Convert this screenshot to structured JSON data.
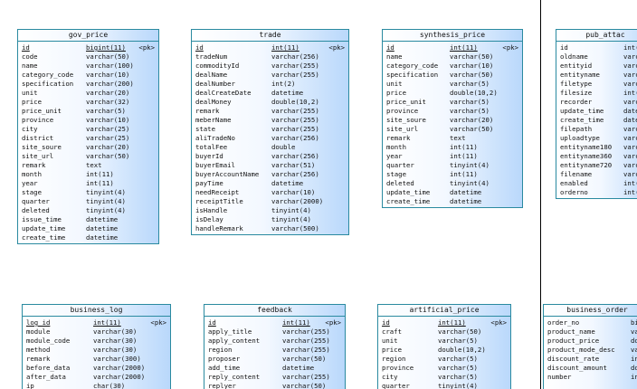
{
  "diagram": {
    "tables": [
      {
        "id": "gov_price",
        "title": "gov_price",
        "columns": [
          {
            "name": "id",
            "type": "bigint(11)",
            "key": "<pk>"
          },
          {
            "name": "code",
            "type": "varchar(50)"
          },
          {
            "name": "name",
            "type": "varchar(100)"
          },
          {
            "name": "category_code",
            "type": "varchar(10)"
          },
          {
            "name": "specification",
            "type": "varchar(200)"
          },
          {
            "name": "unit",
            "type": "varchar(20)"
          },
          {
            "name": "price",
            "type": "varchar(32)"
          },
          {
            "name": "price_unit",
            "type": "varchar(5)"
          },
          {
            "name": "province",
            "type": "varchar(10)"
          },
          {
            "name": "city",
            "type": "varchar(25)"
          },
          {
            "name": "district",
            "type": "varchar(25)"
          },
          {
            "name": "site_soure",
            "type": "varchar(20)"
          },
          {
            "name": "site_url",
            "type": "varchar(50)"
          },
          {
            "name": "remark",
            "type": "text"
          },
          {
            "name": "month",
            "type": "int(11)"
          },
          {
            "name": "year",
            "type": "int(11)"
          },
          {
            "name": "stage",
            "type": "tinyint(4)"
          },
          {
            "name": "quarter",
            "type": "tinyint(4)"
          },
          {
            "name": "deleted",
            "type": "tinyint(4)"
          },
          {
            "name": "issue_time",
            "type": "datetime"
          },
          {
            "name": "update_time",
            "type": "datetime"
          },
          {
            "name": "create_time",
            "type": "datetime"
          }
        ]
      },
      {
        "id": "trade",
        "title": "trade",
        "columns": [
          {
            "name": "id",
            "type": "int(11)",
            "key": "<pk>"
          },
          {
            "name": "tradeNum",
            "type": "varchar(256)"
          },
          {
            "name": "commodityId",
            "type": "varchar(255)"
          },
          {
            "name": "dealName",
            "type": "varchar(255)"
          },
          {
            "name": "dealNumber",
            "type": "int(2)"
          },
          {
            "name": "dealCreateDate",
            "type": "datetime"
          },
          {
            "name": "dealMoney",
            "type": "double(10,2)"
          },
          {
            "name": "remark",
            "type": "varchar(255)"
          },
          {
            "name": "meberName",
            "type": "varchar(255)"
          },
          {
            "name": "state",
            "type": "varchar(255)"
          },
          {
            "name": "aliTradeNo",
            "type": "varchar(256)"
          },
          {
            "name": "totalFee",
            "type": "double"
          },
          {
            "name": "buyerId",
            "type": "varchar(256)"
          },
          {
            "name": "buyerEmail",
            "type": "varchar(51)"
          },
          {
            "name": "buyerAccountName",
            "type": "varchar(256)"
          },
          {
            "name": "payTime",
            "type": "datetime"
          },
          {
            "name": "needReceipt",
            "type": "varchar(10)"
          },
          {
            "name": "receiptTitle",
            "type": "varchar(2000)"
          },
          {
            "name": "isHandle",
            "type": "tinyint(4)"
          },
          {
            "name": "isDelay",
            "type": "tinyint(4)"
          },
          {
            "name": "handleRemark",
            "type": "varchar(500)"
          }
        ]
      },
      {
        "id": "synthesis_price",
        "title": "synthesis_price",
        "columns": [
          {
            "name": "id",
            "type": "int(11)",
            "key": "<pk>"
          },
          {
            "name": "name",
            "type": "varchar(50)"
          },
          {
            "name": "category_code",
            "type": "varchar(10)"
          },
          {
            "name": "specification",
            "type": "varchar(50)"
          },
          {
            "name": "unit",
            "type": "varchar(5)"
          },
          {
            "name": "price",
            "type": "double(10,2)"
          },
          {
            "name": "price_unit",
            "type": "varchar(5)"
          },
          {
            "name": "province",
            "type": "varchar(5)"
          },
          {
            "name": "site_soure",
            "type": "varchar(20)"
          },
          {
            "name": "site_url",
            "type": "varchar(50)"
          },
          {
            "name": "remark",
            "type": "text"
          },
          {
            "name": "month",
            "type": "int(11)"
          },
          {
            "name": "year",
            "type": "int(11)"
          },
          {
            "name": "quarter",
            "type": "tinyint(4)"
          },
          {
            "name": "stage",
            "type": "int(11)"
          },
          {
            "name": "deleted",
            "type": "tinyint(4)"
          },
          {
            "name": "update_time",
            "type": "datetime"
          },
          {
            "name": "create_time",
            "type": "datetime"
          }
        ]
      },
      {
        "id": "pub_attach",
        "title": "pub_attac",
        "columns": [
          {
            "name": "id",
            "type": "int(",
            "key": ""
          },
          {
            "name": "oldname",
            "type": "varc"
          },
          {
            "name": "entityid",
            "type": "varc"
          },
          {
            "name": "entityname",
            "type": "varc"
          },
          {
            "name": "filetype",
            "type": "varc"
          },
          {
            "name": "filesize",
            "type": "int("
          },
          {
            "name": "recorder",
            "type": "varc"
          },
          {
            "name": "update_time",
            "type": "date"
          },
          {
            "name": "create_time",
            "type": "date"
          },
          {
            "name": "filepath",
            "type": "varc"
          },
          {
            "name": "uploadtype",
            "type": "varc"
          },
          {
            "name": "entityname180",
            "type": "varc"
          },
          {
            "name": "entityname360",
            "type": "varc"
          },
          {
            "name": "entityname720",
            "type": "varc"
          },
          {
            "name": "filename",
            "type": "varc"
          },
          {
            "name": "enabled",
            "type": "int("
          },
          {
            "name": "orderno",
            "type": "int("
          }
        ]
      },
      {
        "id": "business_log",
        "title": "business_log",
        "columns": [
          {
            "name": "log_id",
            "type": "int(11)",
            "key": "<pk>"
          },
          {
            "name": "module",
            "type": "varchar(30)"
          },
          {
            "name": "module_code",
            "type": "varchar(30)"
          },
          {
            "name": "method",
            "type": "varchar(30)"
          },
          {
            "name": "remark",
            "type": "varchar(300)"
          },
          {
            "name": "before_data",
            "type": "varchar(2000)"
          },
          {
            "name": "after_data",
            "type": "varchar(2000)"
          },
          {
            "name": "ip",
            "type": "char(30)"
          }
        ]
      },
      {
        "id": "feedback",
        "title": "feedback",
        "columns": [
          {
            "name": "id",
            "type": "int(11)",
            "key": "<pk>"
          },
          {
            "name": "apply_title",
            "type": "varchar(255)"
          },
          {
            "name": "apply_content",
            "type": "varchar(255)"
          },
          {
            "name": "region",
            "type": "varchar(255)"
          },
          {
            "name": "proposer",
            "type": "varchar(50)"
          },
          {
            "name": "add_time",
            "type": "datetime"
          },
          {
            "name": "reply_content",
            "type": "varchar(255)"
          },
          {
            "name": "replyer",
            "type": "varchar(50)"
          }
        ]
      },
      {
        "id": "artificial_price",
        "title": "artificial_price",
        "columns": [
          {
            "name": "id",
            "type": "int(11)",
            "key": "<pk>"
          },
          {
            "name": "craft",
            "type": "varchar(50)"
          },
          {
            "name": "unit",
            "type": "varchar(5)"
          },
          {
            "name": "price",
            "type": "double(10,2)"
          },
          {
            "name": "region",
            "type": "varchar(5)"
          },
          {
            "name": "province",
            "type": "varchar(5)"
          },
          {
            "name": "city",
            "type": "varchar(5)"
          },
          {
            "name": "quarter",
            "type": "tinyint(4)"
          }
        ]
      },
      {
        "id": "business_order",
        "title": "business_order",
        "columns": [
          {
            "name": "order_no",
            "type": "big",
            "key": ""
          },
          {
            "name": "product_name",
            "type": "var"
          },
          {
            "name": "product_price",
            "type": "dou"
          },
          {
            "name": "product_mode_desc",
            "type": "var"
          },
          {
            "name": "discount_rate",
            "type": "int"
          },
          {
            "name": "discount_amount",
            "type": "dou"
          },
          {
            "name": "number",
            "type": "int"
          }
        ]
      }
    ]
  }
}
